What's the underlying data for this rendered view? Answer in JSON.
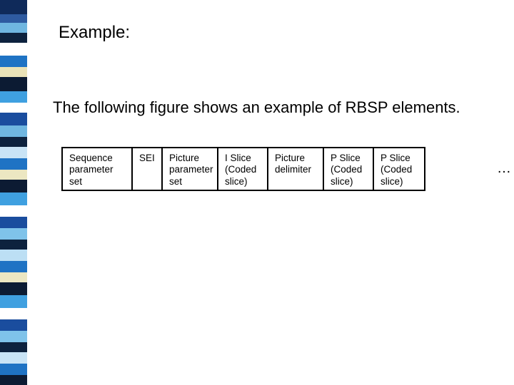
{
  "heading": "Example:",
  "intro": "The following figure shows an example of RBSP elements.",
  "rbsp": {
    "cells": [
      "Sequence parameter set",
      "SEI",
      "Picture parameter set",
      "I Slice (Coded slice)",
      "Picture delimiter",
      "P Slice (Coded slice)",
      "P Slice (Coded slice)"
    ],
    "trailing": "…"
  },
  "deco_colors": [
    {
      "h": 20,
      "c": "#0f2a5a"
    },
    {
      "h": 12,
      "c": "#2e5aa0"
    },
    {
      "h": 14,
      "c": "#6fb6e0"
    },
    {
      "h": 14,
      "c": "#0d223e"
    },
    {
      "h": 18,
      "c": "#ffffff"
    },
    {
      "h": 16,
      "c": "#1f73c4"
    },
    {
      "h": 14,
      "c": "#eae2b7"
    },
    {
      "h": 20,
      "c": "#0c1b33"
    },
    {
      "h": 16,
      "c": "#3fa0e0"
    },
    {
      "h": 14,
      "c": "#ffffff"
    },
    {
      "h": 18,
      "c": "#1a4d9e"
    },
    {
      "h": 16,
      "c": "#6fb6e0"
    },
    {
      "h": 14,
      "c": "#0d223e"
    },
    {
      "h": 16,
      "c": "#c9e4f6"
    },
    {
      "h": 16,
      "c": "#1f73c4"
    },
    {
      "h": 14,
      "c": "#ece7c2"
    },
    {
      "h": 18,
      "c": "#0c1b33"
    },
    {
      "h": 18,
      "c": "#3fa0e0"
    },
    {
      "h": 16,
      "c": "#ffffff"
    },
    {
      "h": 16,
      "c": "#1a4d9e"
    },
    {
      "h": 16,
      "c": "#7fc3ea"
    },
    {
      "h": 14,
      "c": "#0d223e"
    },
    {
      "h": 16,
      "c": "#bcdff4"
    },
    {
      "h": 16,
      "c": "#1f73c4"
    },
    {
      "h": 14,
      "c": "#ece7c2"
    },
    {
      "h": 18,
      "c": "#0c1b33"
    },
    {
      "h": 18,
      "c": "#3fa0e0"
    },
    {
      "h": 16,
      "c": "#ffffff"
    },
    {
      "h": 16,
      "c": "#1a4d9e"
    },
    {
      "h": 16,
      "c": "#7fc3ea"
    },
    {
      "h": 14,
      "c": "#0d223e"
    },
    {
      "h": 16,
      "c": "#c9e4f6"
    },
    {
      "h": 16,
      "c": "#1f73c4"
    },
    {
      "h": 14,
      "c": "#0c1b33"
    }
  ]
}
